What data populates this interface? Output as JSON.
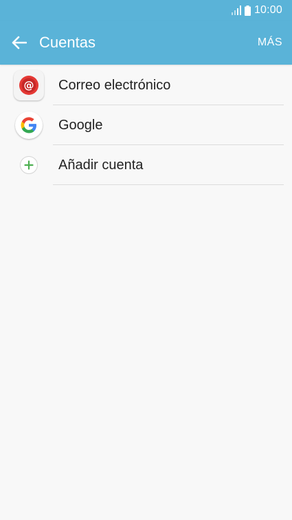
{
  "status_bar": {
    "time": "10:00",
    "signal_icon": "signal-icon",
    "battery_icon": "battery-icon"
  },
  "app_bar": {
    "back_icon": "arrow-back-icon",
    "title": "Cuentas",
    "more_label": "MÁS",
    "background_color": "#5ab3d8"
  },
  "accounts": {
    "items": [
      {
        "label": "Correo electrónico",
        "icon": "email-at-icon",
        "icon_color": "#e53935"
      },
      {
        "label": "Google",
        "icon": "google-g-icon"
      },
      {
        "label": "Añadir cuenta",
        "icon": "add-icon",
        "icon_color": "#4caf50"
      }
    ]
  }
}
